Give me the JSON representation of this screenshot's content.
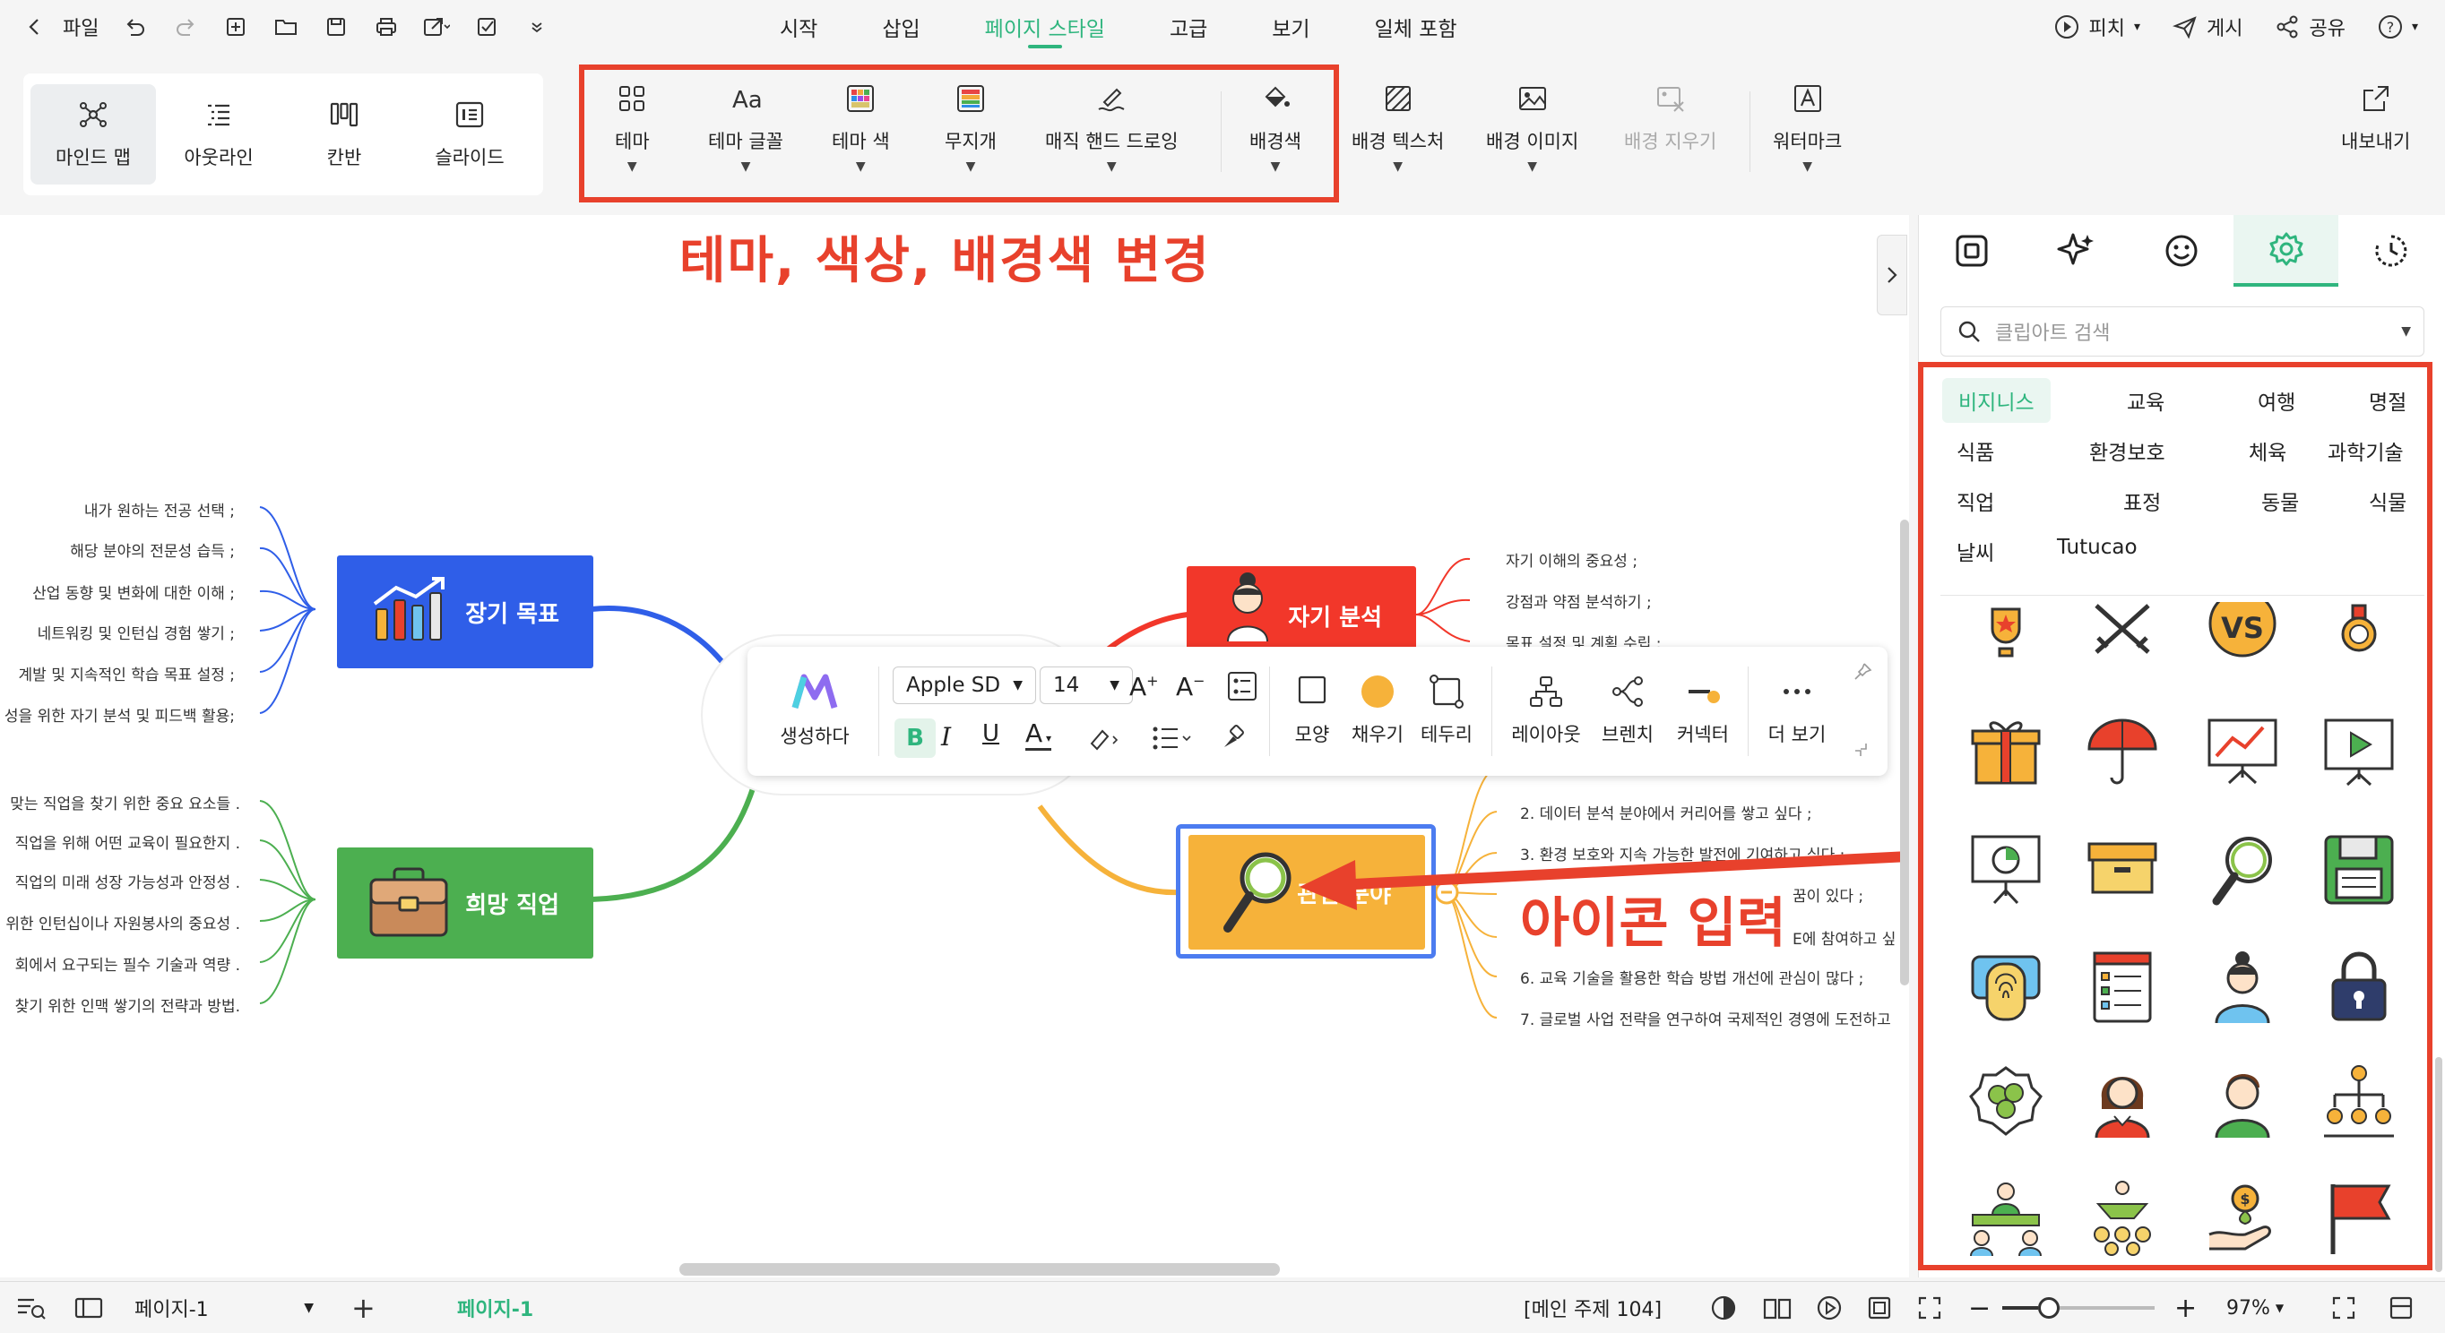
{
  "menu": {
    "file": "파일",
    "tabs": [
      "시작",
      "삽입",
      "페이지 스타일",
      "고급",
      "보기",
      "일체 포함"
    ],
    "active_tab": "페이지 스타일",
    "pitch": "피치",
    "publish": "게시",
    "share": "공유"
  },
  "views": [
    "마인드 맵",
    "아웃라인",
    "칸반",
    "슬라이드"
  ],
  "ribbon": {
    "theme": "테마",
    "theme_font": "테마 글꼴",
    "theme_color": "테마 색",
    "rainbow": "무지개",
    "magic_hand": "매직 핸드 드로잉",
    "bg_color": "배경색",
    "bg_texture": "배경 텍스처",
    "bg_image": "배경 이미지",
    "bg_clear": "배경 지우기",
    "watermark": "워터마크",
    "export": "내보내기"
  },
  "annotations": {
    "theme_change": "테마, 색상, 배경색 변경",
    "icon_input": "아이콘 입력"
  },
  "mindmap": {
    "long_goal": "장기 목표",
    "hope_job": "희망 직업",
    "self_analysis": "자기 분석",
    "interest": "관심 분야",
    "long_goal_leaves": [
      "내가 원하는 전공 선택 ;",
      "해당 분야의 전문성 습득 ;",
      "산업 동향 및 변화에 대한 이해 ;",
      "네트워킹 및 인턴십 경험 쌓기 ;",
      "계발 및 지속적인 학습 목표 설정 ;",
      "성을 위한 자기 분석 및 피드백 활용;"
    ],
    "hope_job_leaves": [
      "맞는 직업을 찾기 위한 중요 요소들 .",
      "직업을 위해 어떤 교육이 필요한지 .",
      "직업의 미래 성장 가능성과 안정성 .",
      "위한 인턴십이나 자원봉사의 중요성 .",
      "회에서 요구되는 필수 기술과 역량 .",
      "찾기 위한 인맥 쌓기의 전략과 방법."
    ],
    "self_leaves": [
      "자기 이해의 중요성 ;",
      "강점과 약점 분석하기 ;",
      "목표 설정 및 계획 수립 ;"
    ],
    "interest_leaves": [
      "2. 데이터 분석 분야에서 커리어를 쌓고 싶다 ;",
      "3. 환경 보호와 지속 가능한 발전에 기여하고 싶다 ;",
      "꿈이 있다 ;",
      "E에 참여하고 싶",
      "6. 교육 기술을 활용한 학습 방법 개선에 관심이 많다 ;",
      "7. 글로벌 사업 전략을 연구하여 국제적인 경영에 도전하고"
    ]
  },
  "floatbar": {
    "generate": "생성하다",
    "font": "Apple SD",
    "size": "14",
    "shape": "모양",
    "fill": "채우기",
    "border": "테두리",
    "layout": "레이아웃",
    "branch": "브렌치",
    "connector": "커넥터",
    "more": "더 보기"
  },
  "panel": {
    "search_placeholder": "클립아트 검색",
    "categories": [
      "비지니스",
      "교육",
      "여행",
      "명절",
      "식품",
      "환경보호",
      "체육",
      "과학기술",
      "직업",
      "표정",
      "동물",
      "식물",
      "날씨",
      "Tutucao"
    ],
    "active_category": "비지니스"
  },
  "status": {
    "page_select": "페이지-1",
    "page_tab": "페이지-1",
    "main_topic": "[메인 주제 104]",
    "zoom": "97%"
  },
  "colors": {
    "accent": "#2fb57e",
    "annotation": "#e8412c",
    "blue_node": "#2f5ee8",
    "green_node": "#4caf50",
    "red_node": "#f2372a",
    "orange_node": "#f6b23a"
  }
}
